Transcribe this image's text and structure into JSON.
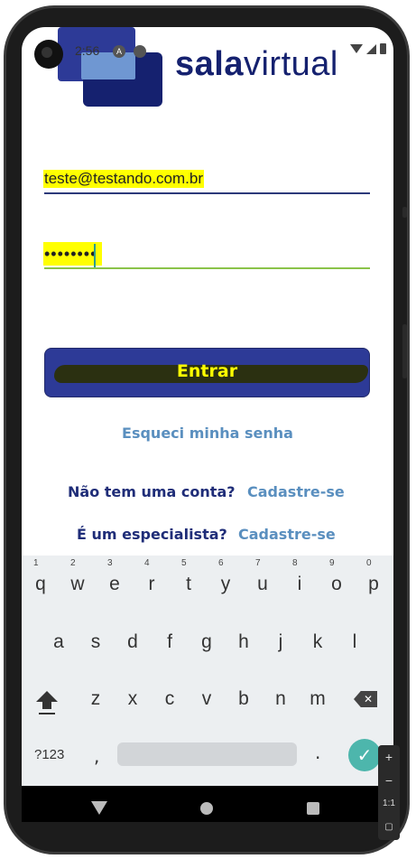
{
  "status_bar": {
    "time": "2:56",
    "notif_icon_a": "A",
    "notif_icon_b": ""
  },
  "brand": {
    "bold": "sala",
    "light": "virtual"
  },
  "login": {
    "email_value": "teste@testando.com.br",
    "password_value": "••••••••",
    "submit_label": "Entrar",
    "forgot_label": "Esqueci minha senha",
    "no_account_label": "Não tem uma conta?",
    "signup_label": "Cadastre-se",
    "specialist_label": "É um especialista?",
    "specialist_signup_label": "Cadastre-se"
  },
  "colors": {
    "primary": "#2d3a97",
    "dark": "#15216f",
    "link": "#5a8fbf",
    "highlight": "#ffff00",
    "accent": "#4db6ac"
  },
  "keyboard": {
    "row1": [
      {
        "k": "q",
        "n": "1"
      },
      {
        "k": "w",
        "n": "2"
      },
      {
        "k": "e",
        "n": "3"
      },
      {
        "k": "r",
        "n": "4"
      },
      {
        "k": "t",
        "n": "5"
      },
      {
        "k": "y",
        "n": "6"
      },
      {
        "k": "u",
        "n": "7"
      },
      {
        "k": "i",
        "n": "8"
      },
      {
        "k": "o",
        "n": "9"
      },
      {
        "k": "p",
        "n": "0"
      }
    ],
    "row2": [
      "a",
      "s",
      "d",
      "f",
      "g",
      "h",
      "j",
      "k",
      "l"
    ],
    "row3": [
      "z",
      "x",
      "c",
      "v",
      "b",
      "n",
      "m"
    ],
    "symbols_label": "?123",
    "comma": ",",
    "period": ".",
    "shift_icon": "shift-icon",
    "backspace_icon": "backspace-icon",
    "enter_icon": "check-icon"
  },
  "emulator_bar": {
    "zoom_in": "+",
    "zoom_out": "−",
    "ratio": "1:1"
  }
}
